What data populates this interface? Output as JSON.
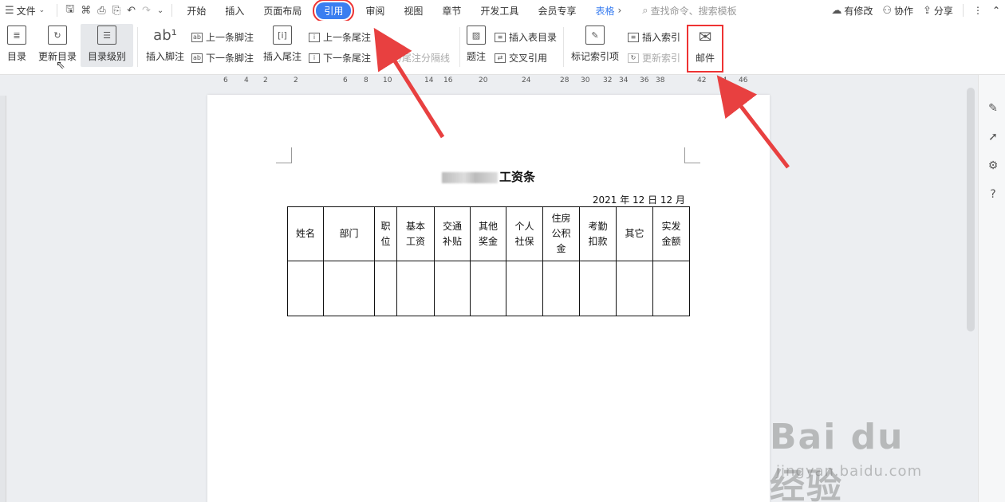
{
  "tabs": {
    "file": "文件",
    "start": "开始",
    "insert": "插入",
    "layout": "页面布局",
    "reference": "引用",
    "review": "审阅",
    "view": "视图",
    "chapter": "章节",
    "dev": "开发工具",
    "member": "会员专享",
    "tabletools": "表格",
    "search_placeholder": "查找命令、搜索模板",
    "modified": "有修改",
    "collab": "协作",
    "share": "分享"
  },
  "ribbon": {
    "toc": "目录",
    "update_toc": "更新目录",
    "toc_level": "目录级别",
    "insert_footnote": "插入脚注",
    "prev_footnote": "上一条脚注",
    "next_footnote": "下一条脚注",
    "insert_endnote": "插入尾注",
    "prev_endnote": "上一条尾注",
    "next_endnote": "下一条尾注",
    "separator": "脚注/尾注分隔线",
    "caption": "题注",
    "insert_table_of_figures": "插入表目录",
    "cross_ref": "交叉引用",
    "mark_index": "标记索引项",
    "insert_index": "插入索引",
    "update_index": "更新索引",
    "mail": "邮件"
  },
  "ruler_ticks": [
    "6",
    "4",
    "2",
    "2",
    "6",
    "8",
    "10",
    "14",
    "16",
    "20",
    "24",
    "28",
    "30",
    "32",
    "34",
    "36",
    "38",
    "42",
    "44",
    "46"
  ],
  "document": {
    "title_suffix": "工资条",
    "date": "2021 年 12 日 12 月",
    "headers": [
      [
        "姓名"
      ],
      [
        "部门"
      ],
      [
        "职",
        "位"
      ],
      [
        "基本",
        "工资"
      ],
      [
        "交通",
        "补贴"
      ],
      [
        "其他",
        "奖金"
      ],
      [
        "个人",
        "社保"
      ],
      [
        "住房",
        "公积",
        "金"
      ],
      [
        "考勤",
        "扣款"
      ],
      [
        "其它"
      ],
      [
        "实发",
        "金额"
      ]
    ]
  },
  "watermark": {
    "logo": "Bai du 经验",
    "url": "jingyan.baidu.com"
  }
}
